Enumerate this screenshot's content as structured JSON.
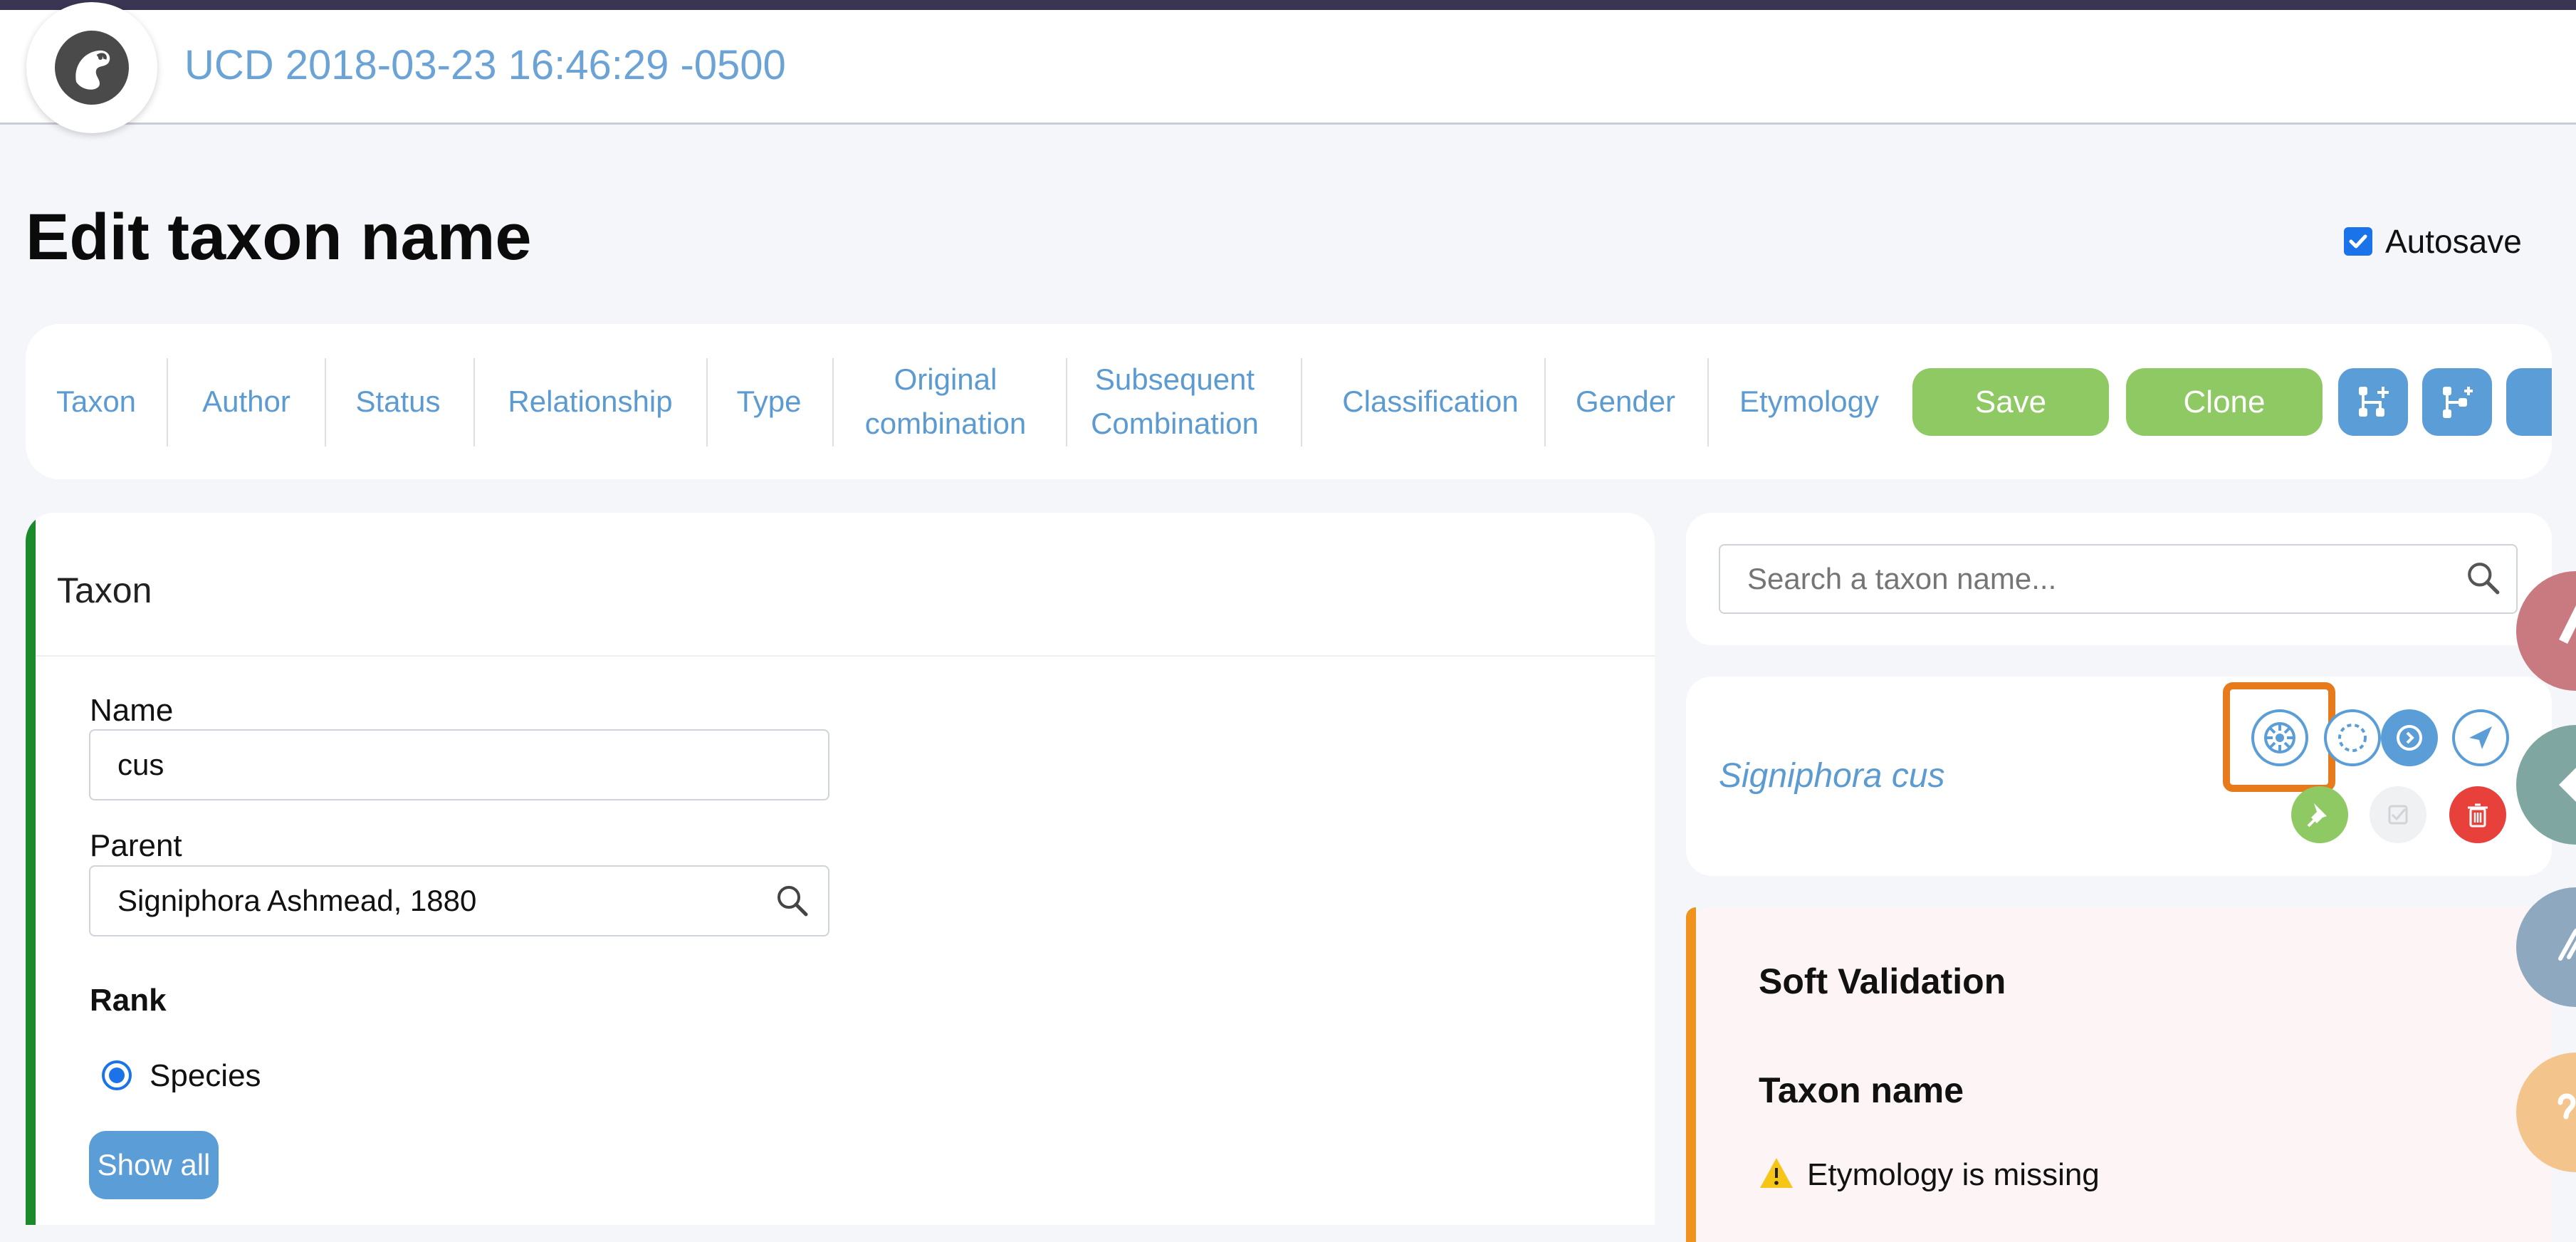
{
  "header": {
    "project_title": "UCD 2018-03-23 16:46:29 -0500"
  },
  "page": {
    "heading": "Edit taxon name",
    "autosave_label": "Autosave",
    "autosave_checked": true
  },
  "nav": {
    "items": [
      {
        "label": "Taxon"
      },
      {
        "label": "Author"
      },
      {
        "label": "Status"
      },
      {
        "label": "Relationship"
      },
      {
        "label": "Type"
      },
      {
        "label": "Original combination"
      },
      {
        "label": "Subsequent Combination"
      },
      {
        "label": "Classification"
      },
      {
        "label": "Gender"
      },
      {
        "label": "Etymology"
      }
    ],
    "save_label": "Save",
    "clone_label": "Clone"
  },
  "taxon_form": {
    "panel_title": "Taxon",
    "name_label": "Name",
    "name_value": "cus",
    "parent_label": "Parent",
    "parent_value": "Signiphora Ashmead, 1880",
    "rank_label": "Rank",
    "rank_selected": "Species",
    "show_all_label": "Show all"
  },
  "sidebar": {
    "search_placeholder": "Search a taxon name...",
    "taxon_preview": "Signiphora cus",
    "validation": {
      "title": "Soft Validation",
      "section": "Taxon name",
      "warning": "Etymology is missing"
    }
  },
  "colors": {
    "accent_blue": "#5b9dd6",
    "link_blue": "#5c9bd1",
    "save_green": "#8fc964",
    "delete_red": "#e8413c",
    "highlight_orange": "#e77a1a",
    "validation_orange": "#f0921e",
    "taxon_green": "#1a8a2a"
  }
}
